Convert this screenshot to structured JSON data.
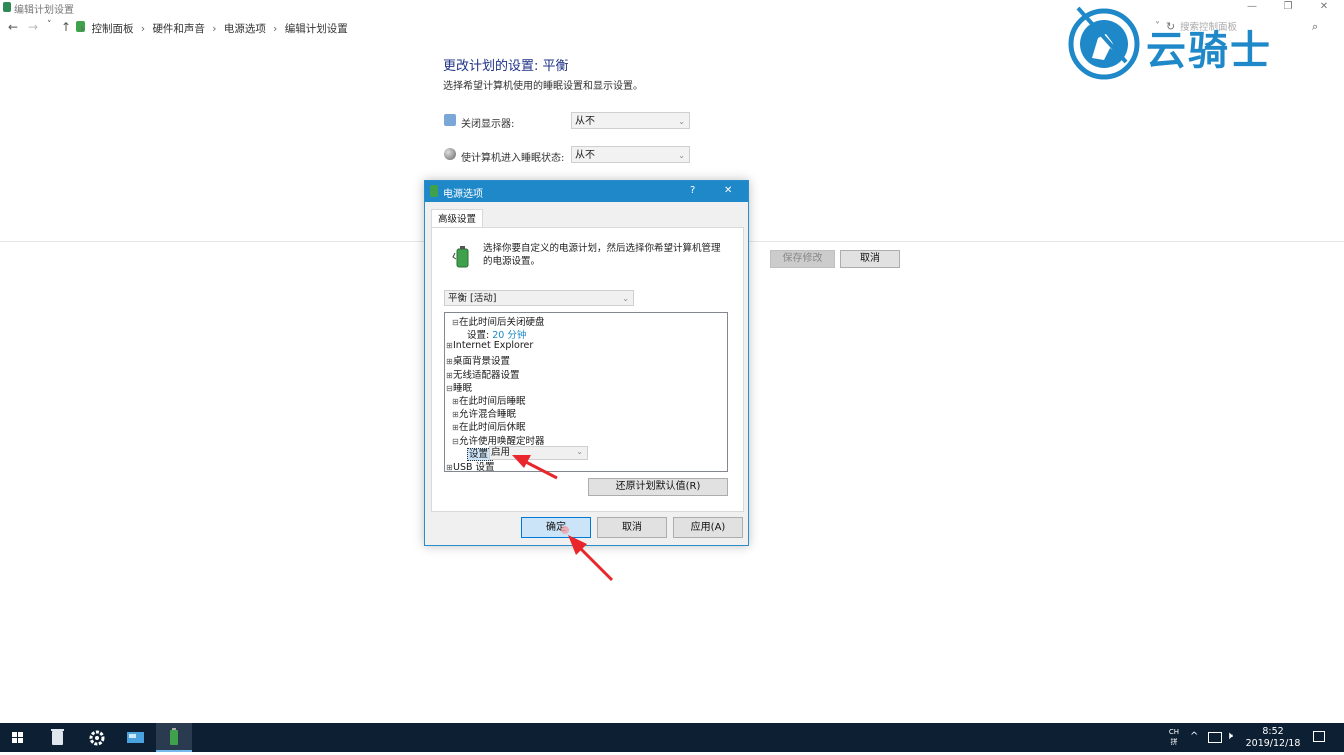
{
  "window": {
    "title": "编辑计划设置",
    "minimize": "—",
    "restore": "❐",
    "close": "✕"
  },
  "addressbar": {
    "back": "←",
    "forward": "→",
    "recent": "˅",
    "up": "↑",
    "crumbs": [
      "控制面板",
      "硬件和声音",
      "电源选项",
      "编辑计划设置"
    ],
    "separator": "›",
    "refresh": "↻",
    "search_placeholder": "搜索控制面板"
  },
  "page": {
    "title": "更改计划的设置: 平衡",
    "subtitle": "选择希望计算机使用的睡眠设置和显示设置。",
    "settings": [
      {
        "label": "关闭显示器:",
        "value": "从不",
        "icon": "monitor-icon"
      },
      {
        "label": "使计算机进入睡眠状态:",
        "value": "从不",
        "icon": "moon-icon"
      }
    ],
    "save_label": "保存修改",
    "cancel_label": "取消"
  },
  "dialog": {
    "title": "电源选项",
    "help": "?",
    "close": "✕",
    "tab": "高级设置",
    "description": "选择你要自定义的电源计划，然后选择你希望计算机管理的电源设置。",
    "plan": "平衡 [活动]",
    "tree": [
      {
        "label": "在此时间后关闭硬盘",
        "expander": "⊟"
      },
      {
        "label": "设置:",
        "value": "20 分钟"
      },
      {
        "label": "Internet Explorer",
        "expander": "⊞"
      },
      {
        "label": "桌面背景设置",
        "expander": "⊞"
      },
      {
        "label": "无线适配器设置",
        "expander": "⊞"
      },
      {
        "label": "睡眠",
        "expander": "⊟"
      },
      {
        "label": "在此时间后睡眠",
        "expander": "⊞"
      },
      {
        "label": "允许混合睡眠",
        "expander": "⊞"
      },
      {
        "label": "在此时间后休眠",
        "expander": "⊞"
      },
      {
        "label": "允许使用唤醒定时器",
        "expander": "⊟"
      },
      {
        "label": "设置:",
        "value": "启用"
      },
      {
        "label": "USB 设置",
        "expander": "⊞"
      }
    ],
    "restore_defaults": "还原计划默认值(R)",
    "ok": "确定",
    "cancel": "取消",
    "apply": "应用(A)"
  },
  "taskbar": {
    "input_mode": "CH",
    "input_sub": "拼",
    "time": "8:52",
    "date": "2019/12/18"
  },
  "watermark": {
    "text": "云骑士"
  },
  "colors": {
    "accent": "#1e88c9",
    "title_blue": "#1e3287",
    "taskbar": "#0d1f33",
    "arrow_red": "#e8262b",
    "highlight": "#cce4f7"
  }
}
